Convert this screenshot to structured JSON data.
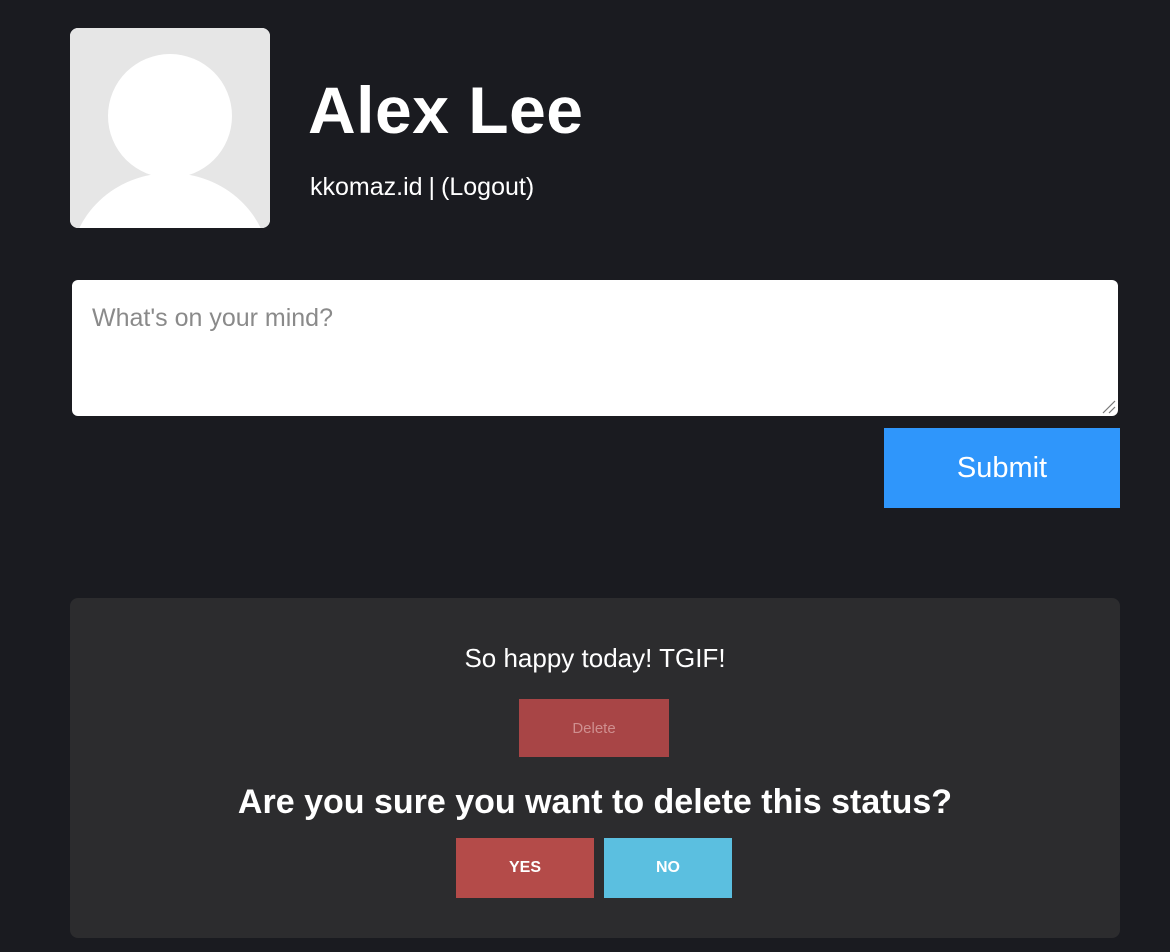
{
  "profile": {
    "name": "Alex Lee",
    "username": "kkomaz.id",
    "separator": "|",
    "logout_label": "(Logout)",
    "avatar_icon": "default-user-avatar"
  },
  "composer": {
    "placeholder": "What's on your mind?",
    "value": "",
    "submit_label": "Submit"
  },
  "status": {
    "text": "So happy today! TGIF!",
    "delete_label": "Delete",
    "confirm_prompt": "Are you sure you want to delete this status?",
    "yes_label": "YES",
    "no_label": "NO"
  },
  "colors": {
    "background": "#1a1b20",
    "card": "#2c2c2e",
    "submit": "#2f96fb",
    "delete": "#a84546",
    "yes": "#b44b49",
    "no": "#5bbfe0"
  }
}
